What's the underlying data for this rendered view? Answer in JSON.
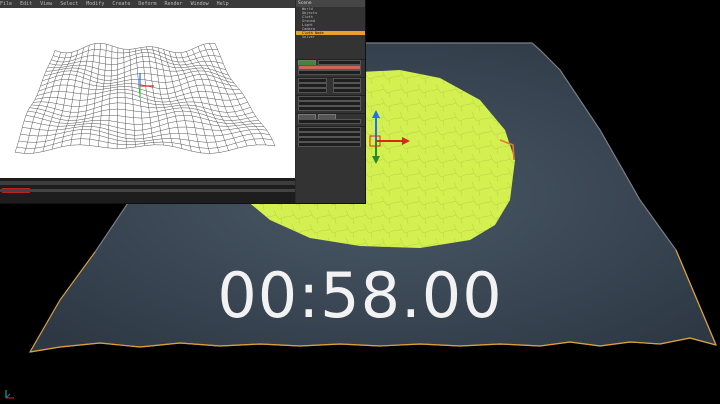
{
  "timer": {
    "value": "00:58.00"
  },
  "colors": {
    "cloth": "#3b4754",
    "green_patch": "#d3f050",
    "edge_orange": "#e0a030",
    "axis_x": "#d02a1a",
    "axis_y": "#2ad23a",
    "axis_z": "#1f6fff"
  },
  "inset": {
    "menu": [
      "File",
      "Edit",
      "View",
      "Select",
      "Modify",
      "Create",
      "Deform",
      "Render",
      "Window",
      "Help"
    ],
    "panel_title": "Scene",
    "tree": [
      "World",
      "Objects",
      "Cloth",
      "Ground",
      "Light",
      "Camera",
      "Cloth Node",
      "Solver"
    ],
    "selected_tree_item": "Cloth Node"
  },
  "icons": [
    "transform-gizmo-icon",
    "axes-orientation-icon"
  ]
}
